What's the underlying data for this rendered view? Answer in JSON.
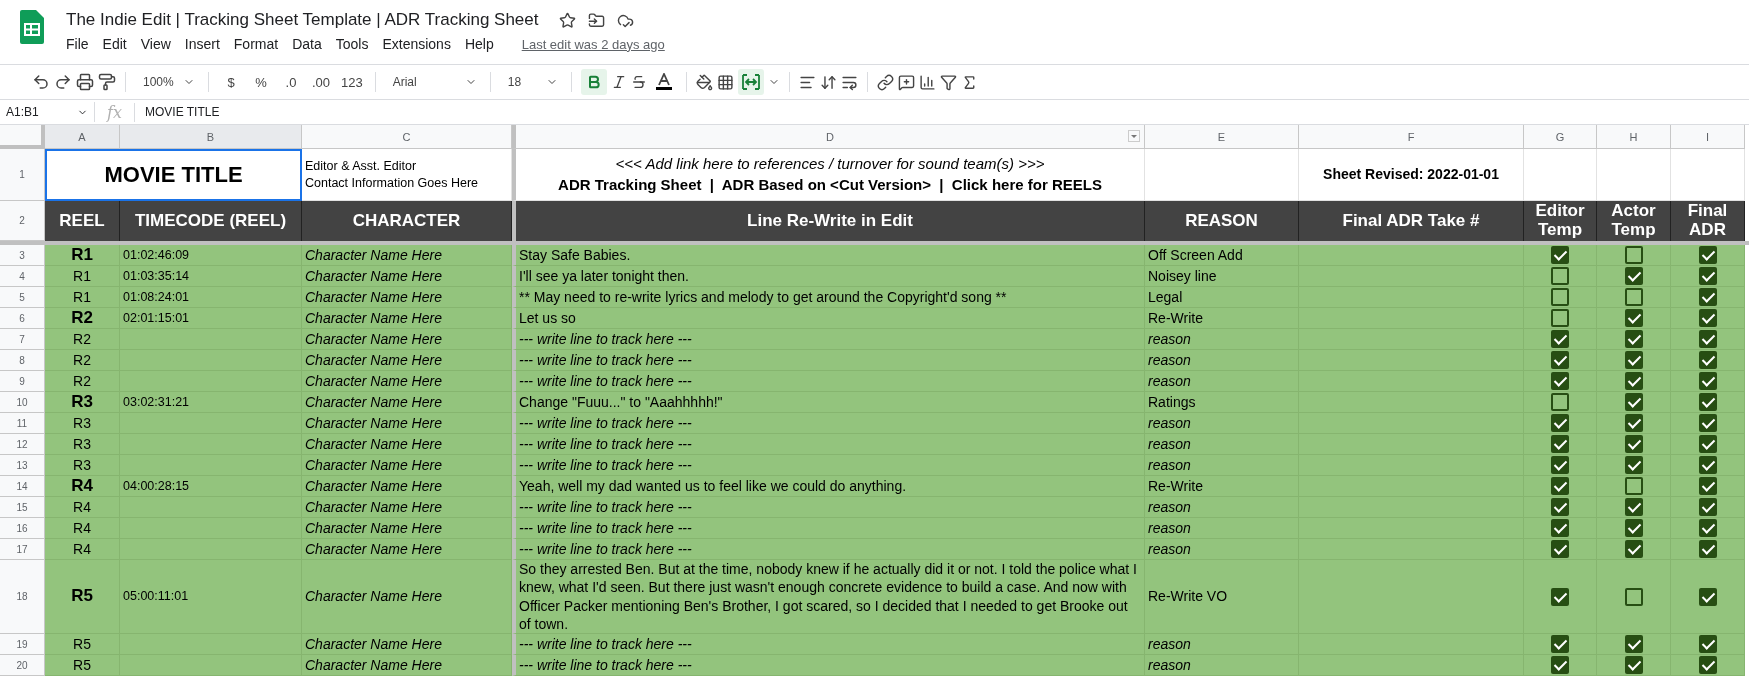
{
  "document": {
    "title": "The Indie Edit | Tracking Sheet Template | ADR Tracking Sheet",
    "last_edit": "Last edit was 2 days ago"
  },
  "menu": [
    "File",
    "Edit",
    "View",
    "Insert",
    "Format",
    "Data",
    "Tools",
    "Extensions",
    "Help"
  ],
  "toolbar": {
    "zoom": "100%",
    "currency": "$",
    "percent": "%",
    "decrease_decimals": ".0",
    "increase_decimals": ".00",
    "number_format": "123",
    "font": "Arial",
    "font_size": "18",
    "bold_on": true,
    "merge_on": true
  },
  "formula_bar": {
    "name_box": "A1:B1",
    "function_label": "fx",
    "value": "MOVIE TITLE"
  },
  "columns": [
    {
      "label": "A",
      "selected": true,
      "has_menu": false
    },
    {
      "label": "B",
      "selected": true,
      "has_menu": false
    },
    {
      "label": "C",
      "selected": false,
      "has_menu": false
    },
    {
      "label": "D",
      "selected": false,
      "has_menu": true
    },
    {
      "label": "E",
      "selected": false,
      "has_menu": false
    },
    {
      "label": "F",
      "selected": false,
      "has_menu": false
    },
    {
      "label": "G",
      "selected": false,
      "has_menu": false
    },
    {
      "label": "H",
      "selected": false,
      "has_menu": false
    },
    {
      "label": "I",
      "selected": false,
      "has_menu": false
    }
  ],
  "title_row": {
    "number": "1",
    "movie_title": "MOVIE TITLE",
    "contact": [
      "Editor & Asst. Editor",
      "Contact Information Goes Here"
    ],
    "link_note": "<<< Add link here to references / turnover for sound team(s) >>>",
    "links_line": "ADR Tracking Sheet  |  ADR Based on <Cut Version>  |  Click here for REELS",
    "revised": "Sheet Revised: 2022-01-01"
  },
  "header_row": {
    "number": "2",
    "headers": [
      "REEL",
      "TIMECODE (REEL)",
      "CHARACTER",
      "Line Re-Write in Edit",
      "REASON",
      "Final ADR Take #",
      "Editor Temp",
      "Actor Temp",
      "Final ADR"
    ]
  },
  "rows": [
    {
      "number": "3",
      "kind": "reel-start",
      "reel": "R1",
      "timecode": "01:02:46:09",
      "character": "Character Name Here",
      "line": "Stay Safe Babies.",
      "reason": "Off Screen Add",
      "filled": true,
      "editor_temp": true,
      "actor_temp": false,
      "final_adr": true
    },
    {
      "number": "4",
      "kind": "line",
      "reel": "R1",
      "timecode": "01:03:35:14",
      "character": "Character Name Here",
      "line": "I'll see ya later tonight then.",
      "reason": "Noisey line",
      "filled": true,
      "editor_temp": false,
      "actor_temp": true,
      "final_adr": true
    },
    {
      "number": "5",
      "kind": "line",
      "reel": "R1",
      "timecode": "01:08:24:01",
      "character": "Character Name Here",
      "line": "** May need to re-write lyrics and melody to get around the Copyright'd song **",
      "reason": "Legal",
      "filled": true,
      "editor_temp": false,
      "actor_temp": false,
      "final_adr": true
    },
    {
      "number": "6",
      "kind": "reel-start",
      "reel": "R2",
      "timecode": "02:01:15:01",
      "character": "Character Name Here",
      "line": "Let us so",
      "reason": "Re-Write",
      "filled": true,
      "editor_temp": false,
      "actor_temp": true,
      "final_adr": true
    },
    {
      "number": "7",
      "kind": "line",
      "reel": "R2",
      "character": "Character Name Here",
      "line": "--- write line to track here ---",
      "reason": "reason",
      "filled": false,
      "editor_temp": true,
      "actor_temp": true,
      "final_adr": true
    },
    {
      "number": "8",
      "kind": "line",
      "reel": "R2",
      "character": "Character Name Here",
      "line": "--- write line to track here ---",
      "reason": "reason",
      "filled": false,
      "editor_temp": true,
      "actor_temp": true,
      "final_adr": true
    },
    {
      "number": "9",
      "kind": "line",
      "reel": "R2",
      "character": "Character Name Here",
      "line": "--- write line to track here ---",
      "reason": "reason",
      "filled": false,
      "editor_temp": true,
      "actor_temp": true,
      "final_adr": true
    },
    {
      "number": "10",
      "kind": "reel-start",
      "reel": "R3",
      "timecode": "03:02:31:21",
      "character": "Character Name Here",
      "line": "Change \"Fuuu...\" to \"Aaahhhhh!\"",
      "reason": "Ratings",
      "filled": true,
      "editor_temp": false,
      "actor_temp": true,
      "final_adr": true
    },
    {
      "number": "11",
      "kind": "line",
      "reel": "R3",
      "character": "Character Name Here",
      "line": "--- write line to track here ---",
      "reason": "reason",
      "filled": false,
      "editor_temp": true,
      "actor_temp": true,
      "final_adr": true
    },
    {
      "number": "12",
      "kind": "line",
      "reel": "R3",
      "character": "Character Name Here",
      "line": "--- write line to track here ---",
      "reason": "reason",
      "filled": false,
      "editor_temp": true,
      "actor_temp": true,
      "final_adr": true
    },
    {
      "number": "13",
      "kind": "line",
      "reel": "R3",
      "character": "Character Name Here",
      "line": "--- write line to track here ---",
      "reason": "reason",
      "filled": false,
      "editor_temp": true,
      "actor_temp": true,
      "final_adr": true
    },
    {
      "number": "14",
      "kind": "reel-start",
      "reel": "R4",
      "timecode": "04:00:28:15",
      "character": "Character Name Here",
      "line": "Yeah, well my dad wanted us to feel like we could do anything.",
      "reason": "Re-Write",
      "filled": true,
      "editor_temp": true,
      "actor_temp": false,
      "final_adr": true
    },
    {
      "number": "15",
      "kind": "line",
      "reel": "R4",
      "character": "Character Name Here",
      "line": "--- write line to track here ---",
      "reason": "reason",
      "filled": false,
      "editor_temp": true,
      "actor_temp": true,
      "final_adr": true
    },
    {
      "number": "16",
      "kind": "line",
      "reel": "R4",
      "character": "Character Name Here",
      "line": "--- write line to track here ---",
      "reason": "reason",
      "filled": false,
      "editor_temp": true,
      "actor_temp": true,
      "final_adr": true
    },
    {
      "number": "17",
      "kind": "line",
      "reel": "R4",
      "character": "Character Name Here",
      "line": "--- write line to track here ---",
      "reason": "reason",
      "filled": false,
      "editor_temp": true,
      "actor_temp": true,
      "final_adr": true
    },
    {
      "number": "18",
      "kind": "reel-start",
      "reel": "R5",
      "timecode": "05:00:11:01",
      "character": "Character Name Here",
      "line": "So they arrested Ben. But at the time, nobody knew if he actually did it or not. I told the police what I knew, what I'd seen. But there just wasn't enough concrete evidence to build a case. And now with Officer Packer mentioning Ben's Brother, I got scared, so I decided that I needed to get Brooke out of town.",
      "reason": "Re-Write VO",
      "filled": true,
      "editor_temp": true,
      "actor_temp": false,
      "final_adr": true
    },
    {
      "number": "19",
      "kind": "line",
      "reel": "R5",
      "character": "Character Name Here",
      "line": "--- write line to track here ---",
      "reason": "reason",
      "filled": false,
      "editor_temp": true,
      "actor_temp": true,
      "final_adr": true
    },
    {
      "number": "20",
      "kind": "line",
      "reel": "R5",
      "character": "Character Name Here",
      "line": "--- write line to track here ---",
      "reason": "reason",
      "filled": false,
      "editor_temp": true,
      "actor_temp": true,
      "final_adr": true
    }
  ]
}
